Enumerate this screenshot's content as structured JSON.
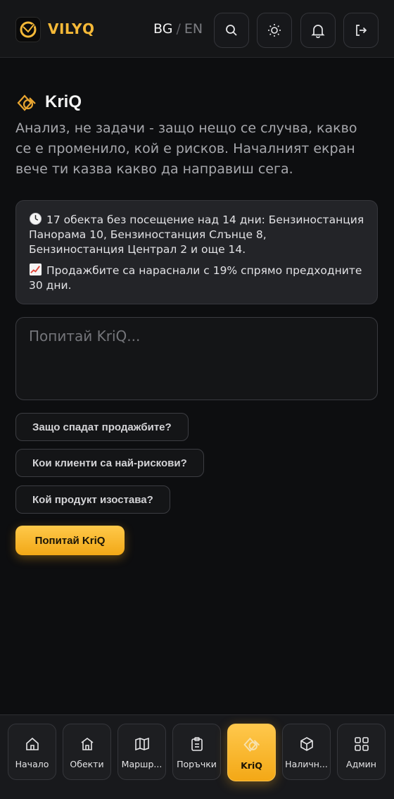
{
  "app": {
    "brand": "VILYQ"
  },
  "language": {
    "active": "BG",
    "separator": "/",
    "inactive": "EN"
  },
  "header": {
    "title": "KriQ",
    "description": "Анализ, не задачи - защо нещо се случва, какво се е променило, кой е рисков. Началният екран вече ти казва какво да направиш сега."
  },
  "insights": [
    {
      "icon": "clock-icon",
      "text": "17 обекта без посещение над 14 дни: Бензиностанция Панорама 10, Бензиностанция Слънце 8, Бензиностанция Централ 2 и още 14."
    },
    {
      "icon": "chart-increasing-icon",
      "text": "Продажбите са нараснали с 19% спрямо предходните 30 дни."
    }
  ],
  "ask": {
    "placeholder": "Попитай KriQ..."
  },
  "suggestions": [
    "Защо спадат продажбите?",
    "Кои клиенти са най-рискови?",
    "Кой продукт изостава?"
  ],
  "cta": {
    "label": "Попитай KriQ"
  },
  "nav": [
    {
      "label": "Начало",
      "icon": "home-icon",
      "active": false
    },
    {
      "label": "Обекти",
      "icon": "building-icon",
      "active": false
    },
    {
      "label": "Маршр...",
      "icon": "map-icon",
      "active": false
    },
    {
      "label": "Поръчки",
      "icon": "clipboard-icon",
      "active": false
    },
    {
      "label": "KriQ",
      "icon": "kriq-logo-icon",
      "active": true
    },
    {
      "label": "Наличн...",
      "icon": "box-icon",
      "active": false
    },
    {
      "label": "Админ",
      "icon": "grid-icon",
      "active": false
    }
  ],
  "colors": {
    "accent": "#f5b938",
    "background": "#0d0e10",
    "card": "#232428"
  }
}
